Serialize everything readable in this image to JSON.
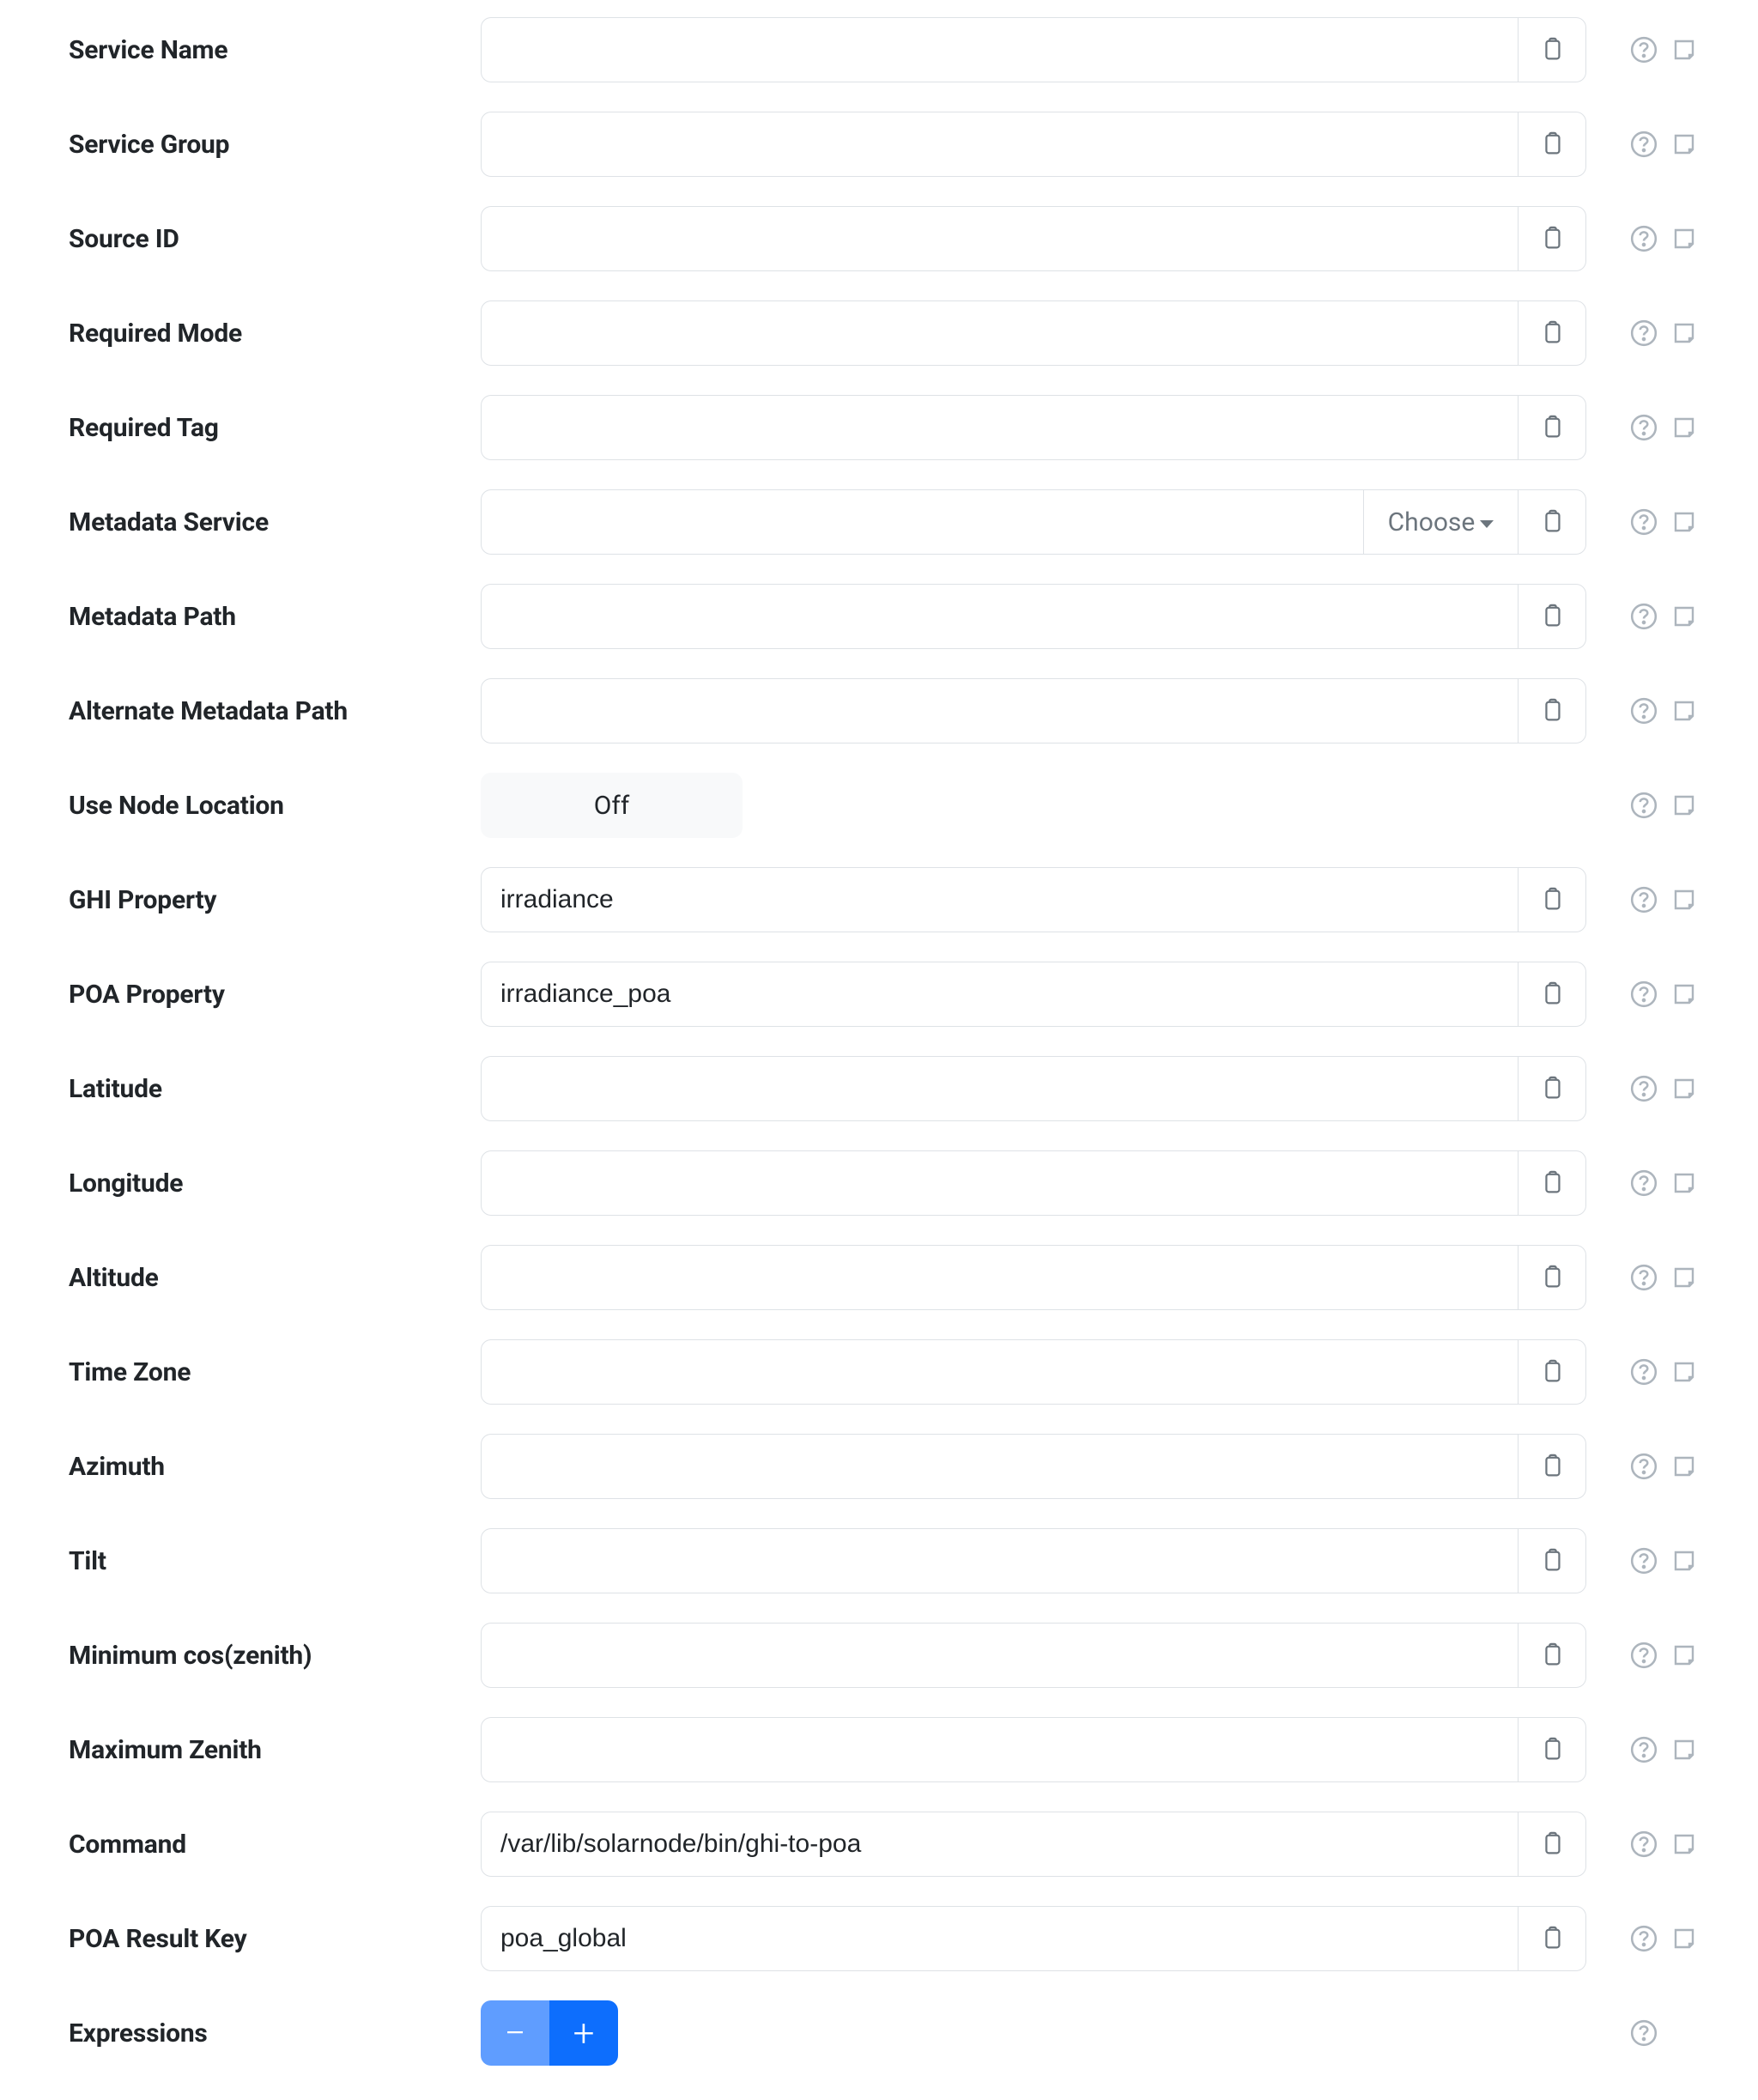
{
  "labels": {
    "service_name": "Service Name",
    "service_group": "Service Group",
    "source_id": "Source ID",
    "required_mode": "Required Mode",
    "required_tag": "Required Tag",
    "metadata_service": "Metadata Service",
    "metadata_path": "Metadata Path",
    "alternate_metadata_path": "Alternate Metadata Path",
    "use_node_location": "Use Node Location",
    "ghi_property": "GHI Property",
    "poa_property": "POA Property",
    "latitude": "Latitude",
    "longitude": "Longitude",
    "altitude": "Altitude",
    "time_zone": "Time Zone",
    "azimuth": "Azimuth",
    "tilt": "Tilt",
    "minimum_cos_zenith": "Minimum cos(zenith)",
    "maximum_zenith": "Maximum Zenith",
    "command": "Command",
    "poa_result_key": "POA Result Key",
    "expressions": "Expressions"
  },
  "values": {
    "service_name": "",
    "service_group": "",
    "source_id": "",
    "required_mode": "",
    "required_tag": "",
    "metadata_service": "",
    "metadata_path": "",
    "alternate_metadata_path": "",
    "ghi_property": "irradiance",
    "poa_property": "irradiance_poa",
    "latitude": "",
    "longitude": "",
    "altitude": "",
    "time_zone": "",
    "azimuth": "",
    "tilt": "",
    "minimum_cos_zenith": "",
    "maximum_zenith": "",
    "command": "/var/lib/solarnode/bin/ghi-to-poa",
    "poa_result_key": "poa_global"
  },
  "ui": {
    "choose": "Choose",
    "off": "Off",
    "minus": "−",
    "plus": "+"
  }
}
